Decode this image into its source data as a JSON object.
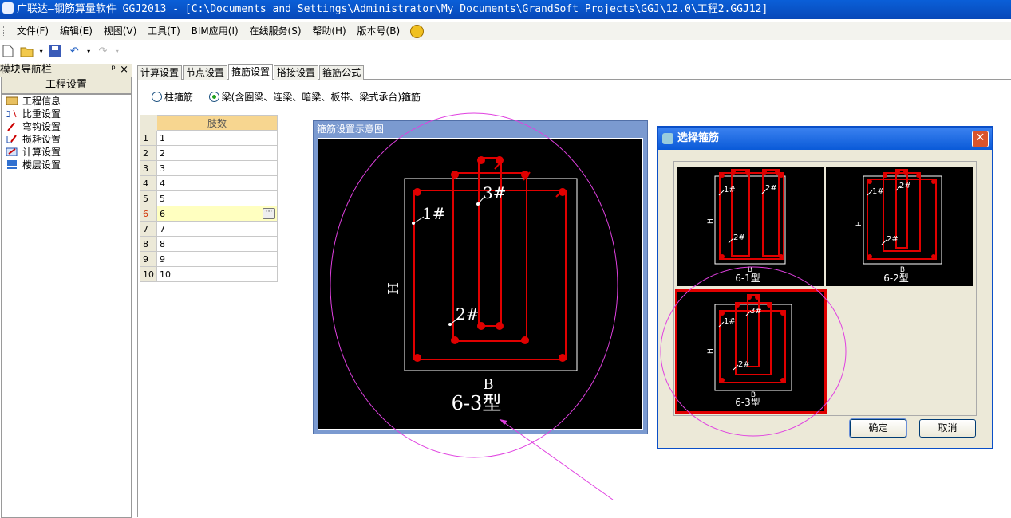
{
  "window": {
    "title": "广联达—钢筋算量软件 GGJ2013 - [C:\\Documents and Settings\\Administrator\\My Documents\\GrandSoft Projects\\GGJ\\12.0\\工程2.GGJ12]"
  },
  "menu": {
    "items": [
      "文件(F)",
      "编辑(E)",
      "视图(V)",
      "工具(T)",
      "BIM应用(I)",
      "在线服务(S)",
      "帮助(H)",
      "版本号(B)"
    ]
  },
  "toolbar": {
    "icons": [
      "new-icon",
      "open-icon",
      "save-icon",
      "undo-icon",
      "redo-icon"
    ]
  },
  "nav": {
    "panel_title": "模块导航栏",
    "pin_glyph": "ᵖ",
    "close_glyph": "×",
    "section": "工程设置",
    "items": [
      "工程信息",
      "比重设置",
      "弯钩设置",
      "损耗设置",
      "计算设置",
      "楼层设置"
    ]
  },
  "tabs": [
    "计算设置",
    "节点设置",
    "箍筋设置",
    "搭接设置",
    "箍筋公式"
  ],
  "radios": {
    "column": "柱箍筋",
    "beam": "梁(含圈梁、连梁、暗梁、板带、梁式承台)箍筋"
  },
  "grid": {
    "header": "肢数",
    "rows": [
      {
        "num": "1",
        "val": "1"
      },
      {
        "num": "2",
        "val": "2"
      },
      {
        "num": "3",
        "val": "3"
      },
      {
        "num": "4",
        "val": "4"
      },
      {
        "num": "5",
        "val": "5"
      },
      {
        "num": "6",
        "val": "6"
      },
      {
        "num": "7",
        "val": "7"
      },
      {
        "num": "8",
        "val": "8"
      },
      {
        "num": "9",
        "val": "9"
      },
      {
        "num": "10",
        "val": "10"
      }
    ],
    "selected_row": 6,
    "ellipsis": "···"
  },
  "diagram": {
    "title": "箍筋设置示意图",
    "label_h": "H",
    "label_b": "B",
    "label_1": "1#",
    "label_2": "2#",
    "label_3": "3#",
    "type_label": "6-3型"
  },
  "dialog": {
    "title": "选择箍筋",
    "close": "✕",
    "options": [
      {
        "type": "6-1型",
        "h": "H",
        "b": "B",
        "l1": "1#",
        "l2": "2#"
      },
      {
        "type": "6-2型",
        "h": "H",
        "b": "B",
        "l1": "1#",
        "l2": "2#",
        "l3": "2#"
      },
      {
        "type": "6-3型",
        "h": "H",
        "b": "B",
        "l1": "1#",
        "l2": "2#",
        "l3": "3#"
      }
    ],
    "selected_option": "6-3型",
    "ok_label": "确定",
    "cancel_label": "取消"
  },
  "colors": {
    "rebar": "#e00000",
    "annotation": "#e040e0",
    "title_bar": "#0a5fd8"
  }
}
